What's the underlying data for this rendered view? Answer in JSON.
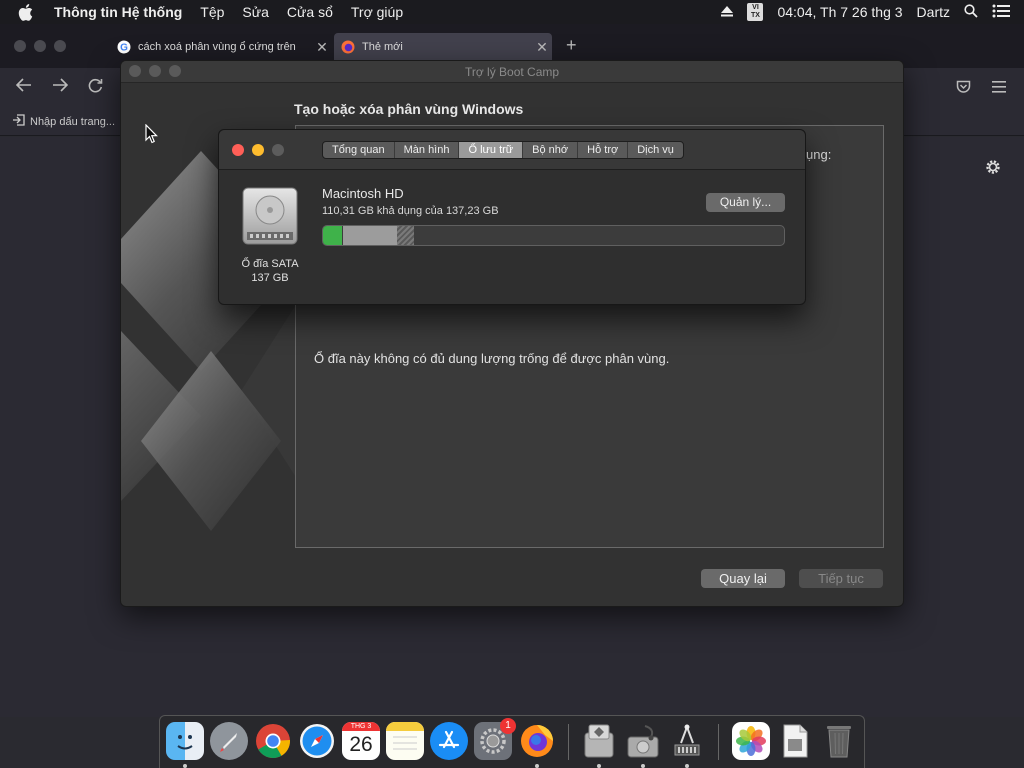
{
  "menubar": {
    "app_name": "Thông tin Hệ thống",
    "items": [
      "Tệp",
      "Sửa",
      "Cửa sổ",
      "Trợ giúp"
    ],
    "input_source": "VI TX",
    "clock": "04:04, Th 7 26 thg 3",
    "user": "Dartz"
  },
  "firefox": {
    "tabs": [
      {
        "label": "cách xoá phân vùng ổ cứng trên",
        "close": "✕"
      },
      {
        "label": "Thẻ mới",
        "close": "✕"
      }
    ],
    "new_tab": "+",
    "bookmark_import": "Nhập dấu trang..."
  },
  "bootcamp": {
    "window_title": "Trợ lý Boot Camp",
    "heading": "Tạo hoặc xóa phân vùng Windows",
    "partial_text": "ụng:",
    "message": "Ổ đĩa này không có đủ dung lượng trống để được phân vùng.",
    "back_button": "Quay lại",
    "next_button": "Tiếp tục"
  },
  "sysinfo": {
    "tabs": [
      "Tổng quan",
      "Màn hình",
      "Ổ lưu trữ",
      "Bộ nhớ",
      "Hỗ trợ",
      "Dịch vụ"
    ],
    "active_tab": "Ổ lưu trữ",
    "drive_name": "Macintosh HD",
    "availability": "110,31 GB khả dụng của 137,23 GB",
    "manage_button": "Quản lý...",
    "drive_type": "Ổ đĩa SATA",
    "drive_size": "137 GB",
    "usage_fraction_used": 0.196
  },
  "dock": {
    "items": [
      "finder-icon",
      "launchpad-icon",
      "chrome-icon",
      "safari-icon",
      "calendar-icon",
      "notes-icon",
      "app-store-icon",
      "system-preferences-icon",
      "firefox-icon",
      "boot-camp-assistant-icon",
      "disk-utility-icon",
      "system-information-icon",
      "photos-icon",
      "preview-icon",
      "trash-icon"
    ],
    "calendar_month": "THG 3",
    "calendar_day": "26",
    "badge_count": "1"
  },
  "colors": {
    "accent_close": "#ff5f57",
    "accent_minimize": "#febc2e",
    "storage_green": "#3fb24a"
  }
}
